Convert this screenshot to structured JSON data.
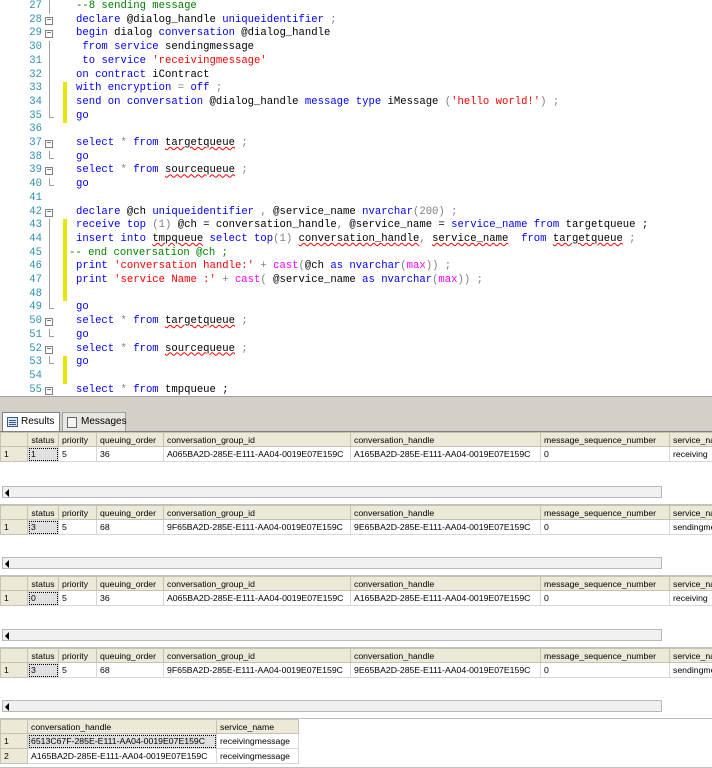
{
  "editor": {
    "lines": [
      {
        "n": "27",
        "tokens": [
          {
            "t": "--8 sending message",
            "c": "cmt"
          }
        ],
        "marker": false,
        "fold": "line"
      },
      {
        "n": "28",
        "tokens": [
          {
            "t": "declare",
            "c": "kw"
          },
          {
            "t": " @dialog_handle ",
            "c": "plain"
          },
          {
            "t": "uniqueidentifier",
            "c": "kw"
          },
          {
            "t": " ;",
            "c": "gray"
          }
        ],
        "marker": false,
        "fold": "box"
      },
      {
        "n": "29",
        "tokens": [
          {
            "t": "begin",
            "c": "kw"
          },
          {
            "t": " dialog ",
            "c": "plain"
          },
          {
            "t": "conversation",
            "c": "kw"
          },
          {
            "t": " @dialog_handle",
            "c": "plain"
          }
        ],
        "marker": false,
        "fold": "box"
      },
      {
        "n": "30",
        "tokens": [
          {
            "t": " from",
            "c": "kw"
          },
          {
            "t": " ",
            "c": "plain"
          },
          {
            "t": "service",
            "c": "kw"
          },
          {
            "t": " sendingmessage",
            "c": "plain"
          }
        ],
        "marker": false,
        "fold": "line"
      },
      {
        "n": "31",
        "tokens": [
          {
            "t": " to",
            "c": "kw"
          },
          {
            "t": " ",
            "c": "plain"
          },
          {
            "t": "service",
            "c": "kw"
          },
          {
            "t": " ",
            "c": "plain"
          },
          {
            "t": "'receivingmessage'",
            "c": "str"
          }
        ],
        "marker": false,
        "fold": "line"
      },
      {
        "n": "32",
        "tokens": [
          {
            "t": "on",
            "c": "kw"
          },
          {
            "t": " ",
            "c": "plain"
          },
          {
            "t": "contract",
            "c": "kw"
          },
          {
            "t": " iContract",
            "c": "plain"
          }
        ],
        "marker": false,
        "fold": "line"
      },
      {
        "n": "33",
        "tokens": [
          {
            "t": "with",
            "c": "kw"
          },
          {
            "t": " ",
            "c": "plain"
          },
          {
            "t": "encryption",
            "c": "kw"
          },
          {
            "t": " = ",
            "c": "gray"
          },
          {
            "t": "off",
            "c": "kw"
          },
          {
            "t": " ;",
            "c": "gray"
          }
        ],
        "marker": true,
        "fold": "line"
      },
      {
        "n": "34",
        "tokens": [
          {
            "t": "send",
            "c": "kw"
          },
          {
            "t": " ",
            "c": "plain"
          },
          {
            "t": "on",
            "c": "kw"
          },
          {
            "t": " ",
            "c": "plain"
          },
          {
            "t": "conversation",
            "c": "kw"
          },
          {
            "t": " @dialog_handle ",
            "c": "plain"
          },
          {
            "t": "message",
            "c": "kw"
          },
          {
            "t": " ",
            "c": "plain"
          },
          {
            "t": "type",
            "c": "kw"
          },
          {
            "t": " iMessage ",
            "c": "plain"
          },
          {
            "t": "(",
            "c": "gray"
          },
          {
            "t": "'hello world!'",
            "c": "str"
          },
          {
            "t": ") ;",
            "c": "gray"
          }
        ],
        "marker": true,
        "fold": "line"
      },
      {
        "n": "35",
        "tokens": [
          {
            "t": "go",
            "c": "kw"
          }
        ],
        "marker": true,
        "fold": "end"
      },
      {
        "n": "36",
        "tokens": [],
        "marker": false,
        "fold": "none"
      },
      {
        "n": "37",
        "tokens": [
          {
            "t": "select",
            "c": "kw"
          },
          {
            "t": " * ",
            "c": "gray"
          },
          {
            "t": "from",
            "c": "kw"
          },
          {
            "t": " ",
            "c": "plain"
          },
          {
            "t": "targetqueue",
            "c": "squig"
          },
          {
            "t": " ;",
            "c": "gray"
          }
        ],
        "marker": false,
        "fold": "box"
      },
      {
        "n": "38",
        "tokens": [
          {
            "t": "go",
            "c": "kw"
          }
        ],
        "marker": false,
        "fold": "end"
      },
      {
        "n": "39",
        "tokens": [
          {
            "t": "select",
            "c": "kw"
          },
          {
            "t": " * ",
            "c": "gray"
          },
          {
            "t": "from",
            "c": "kw"
          },
          {
            "t": " ",
            "c": "plain"
          },
          {
            "t": "sourcequeue",
            "c": "squig"
          },
          {
            "t": " ;",
            "c": "gray"
          }
        ],
        "marker": false,
        "fold": "box"
      },
      {
        "n": "40",
        "tokens": [
          {
            "t": "go",
            "c": "kw"
          }
        ],
        "marker": false,
        "fold": "end"
      },
      {
        "n": "41",
        "tokens": [],
        "marker": false,
        "fold": "none"
      },
      {
        "n": "42",
        "tokens": [
          {
            "t": "declare",
            "c": "kw"
          },
          {
            "t": " @ch ",
            "c": "plain"
          },
          {
            "t": "uniqueidentifier",
            "c": "kw"
          },
          {
            "t": " , ",
            "c": "gray"
          },
          {
            "t": "@service_name ",
            "c": "plain"
          },
          {
            "t": "nvarchar",
            "c": "kw"
          },
          {
            "t": "(200) ;",
            "c": "gray"
          }
        ],
        "marker": false,
        "fold": "box"
      },
      {
        "n": "43",
        "tokens": [
          {
            "t": "receive",
            "c": "kw"
          },
          {
            "t": " ",
            "c": "plain"
          },
          {
            "t": "top",
            "c": "kw"
          },
          {
            "t": " (1) ",
            "c": "gray"
          },
          {
            "t": "@ch = ",
            "c": "plain"
          },
          {
            "t": "conversation_handle",
            "c": "plain"
          },
          {
            "t": ", ",
            "c": "gray"
          },
          {
            "t": "@service_name = ",
            "c": "plain"
          },
          {
            "t": "service_name",
            "c": "kw"
          },
          {
            "t": " ",
            "c": "plain"
          },
          {
            "t": "from",
            "c": "kw"
          },
          {
            "t": " targetqueue ;",
            "c": "plain"
          }
        ],
        "marker": true,
        "fold": "line"
      },
      {
        "n": "44",
        "tokens": [
          {
            "t": "insert",
            "c": "kw"
          },
          {
            "t": " ",
            "c": "plain"
          },
          {
            "t": "into",
            "c": "kw"
          },
          {
            "t": " ",
            "c": "plain"
          },
          {
            "t": "tmpqueue",
            "c": "squig"
          },
          {
            "t": " ",
            "c": "plain"
          },
          {
            "t": "select",
            "c": "kw"
          },
          {
            "t": " ",
            "c": "plain"
          },
          {
            "t": "top",
            "c": "kw"
          },
          {
            "t": "(1) ",
            "c": "gray"
          },
          {
            "t": "conversation_handle",
            "c": "squig"
          },
          {
            "t": ", ",
            "c": "gray"
          },
          {
            "t": "service_name",
            "c": "squig"
          },
          {
            "t": "  ",
            "c": "plain"
          },
          {
            "t": "from",
            "c": "kw"
          },
          {
            "t": " ",
            "c": "plain"
          },
          {
            "t": "targetqueue",
            "c": "squig"
          },
          {
            "t": " ;",
            "c": "gray"
          }
        ],
        "marker": true,
        "fold": "line"
      },
      {
        "n": "45",
        "tokens": [
          {
            "t": "-- end conversation @ch ;",
            "c": "cmt"
          }
        ],
        "marker": true,
        "fold": "line",
        "indent": -1
      },
      {
        "n": "46",
        "tokens": [
          {
            "t": "print",
            "c": "kw"
          },
          {
            "t": " ",
            "c": "plain"
          },
          {
            "t": "'conversation handle:'",
            "c": "str"
          },
          {
            "t": " + ",
            "c": "gray"
          },
          {
            "t": "cast",
            "c": "fn"
          },
          {
            "t": "(",
            "c": "gray"
          },
          {
            "t": "@ch ",
            "c": "plain"
          },
          {
            "t": "as",
            "c": "kw"
          },
          {
            "t": " ",
            "c": "plain"
          },
          {
            "t": "nvarchar",
            "c": "kw"
          },
          {
            "t": "(",
            "c": "gray"
          },
          {
            "t": "max",
            "c": "fn"
          },
          {
            "t": ")) ;",
            "c": "gray"
          }
        ],
        "marker": true,
        "fold": "line"
      },
      {
        "n": "47",
        "tokens": [
          {
            "t": "print",
            "c": "kw"
          },
          {
            "t": " ",
            "c": "plain"
          },
          {
            "t": "'service Name :'",
            "c": "str"
          },
          {
            "t": " + ",
            "c": "gray"
          },
          {
            "t": "cast",
            "c": "fn"
          },
          {
            "t": "( ",
            "c": "gray"
          },
          {
            "t": "@service_name ",
            "c": "plain"
          },
          {
            "t": "as",
            "c": "kw"
          },
          {
            "t": " ",
            "c": "plain"
          },
          {
            "t": "nvarchar",
            "c": "kw"
          },
          {
            "t": "(",
            "c": "gray"
          },
          {
            "t": "max",
            "c": "fn"
          },
          {
            "t": ")) ;",
            "c": "gray"
          }
        ],
        "marker": true,
        "fold": "line"
      },
      {
        "n": "48",
        "tokens": [],
        "marker": true,
        "fold": "line"
      },
      {
        "n": "49",
        "tokens": [
          {
            "t": "go",
            "c": "kw"
          }
        ],
        "marker": false,
        "fold": "end"
      },
      {
        "n": "50",
        "tokens": [
          {
            "t": "select",
            "c": "kw"
          },
          {
            "t": " * ",
            "c": "gray"
          },
          {
            "t": "from",
            "c": "kw"
          },
          {
            "t": " ",
            "c": "plain"
          },
          {
            "t": "targetqueue",
            "c": "squig"
          },
          {
            "t": " ;",
            "c": "gray"
          }
        ],
        "marker": false,
        "fold": "box"
      },
      {
        "n": "51",
        "tokens": [
          {
            "t": "go",
            "c": "kw"
          }
        ],
        "marker": false,
        "fold": "end"
      },
      {
        "n": "52",
        "tokens": [
          {
            "t": "select",
            "c": "kw"
          },
          {
            "t": " * ",
            "c": "gray"
          },
          {
            "t": "from",
            "c": "kw"
          },
          {
            "t": " ",
            "c": "plain"
          },
          {
            "t": "sourcequeue",
            "c": "squig"
          },
          {
            "t": " ;",
            "c": "gray"
          }
        ],
        "marker": false,
        "fold": "box"
      },
      {
        "n": "53",
        "tokens": [
          {
            "t": "go",
            "c": "kw"
          }
        ],
        "marker": true,
        "fold": "end"
      },
      {
        "n": "54",
        "tokens": [],
        "marker": true,
        "fold": "none"
      },
      {
        "n": "55",
        "tokens": [
          {
            "t": "select",
            "c": "kw"
          },
          {
            "t": " * ",
            "c": "gray"
          },
          {
            "t": "from",
            "c": "kw"
          },
          {
            "t": " tmpqueue ;",
            "c": "plain"
          }
        ],
        "marker": false,
        "fold": "box"
      }
    ]
  },
  "tabs": {
    "results": "Results",
    "messages": "Messages"
  },
  "grids": [
    {
      "columns": [
        "status",
        "priority",
        "queuing_order",
        "conversation_group_id",
        "conversation_handle",
        "message_sequence_number",
        "service_na"
      ],
      "rows": [
        {
          "num": "1",
          "cells": [
            "1",
            "5",
            "36",
            "A065BA2D-285E-E111-AA04-0019E07E159C",
            "A165BA2D-285E-E111-AA04-0019E07E159C",
            "0",
            "receiving"
          ]
        }
      ]
    },
    {
      "columns": [
        "status",
        "priority",
        "queuing_order",
        "conversation_group_id",
        "conversation_handle",
        "message_sequence_number",
        "service_na"
      ],
      "rows": [
        {
          "num": "1",
          "cells": [
            "3",
            "5",
            "68",
            "9F65BA2D-285E-E111-AA04-0019E07E159C",
            "9E65BA2D-285E-E111-AA04-0019E07E159C",
            "0",
            "sendingme"
          ]
        }
      ]
    },
    {
      "columns": [
        "status",
        "priority",
        "queuing_order",
        "conversation_group_id",
        "conversation_handle",
        "message_sequence_number",
        "service_na"
      ],
      "rows": [
        {
          "num": "1",
          "cells": [
            "0",
            "5",
            "36",
            "A065BA2D-285E-E111-AA04-0019E07E159C",
            "A165BA2D-285E-E111-AA04-0019E07E159C",
            "0",
            "receiving"
          ]
        }
      ]
    },
    {
      "columns": [
        "status",
        "priority",
        "queuing_order",
        "conversation_group_id",
        "conversation_handle",
        "message_sequence_number",
        "service_na"
      ],
      "rows": [
        {
          "num": "1",
          "cells": [
            "3",
            "5",
            "68",
            "9F65BA2D-285E-E111-AA04-0019E07E159C",
            "9E65BA2D-285E-E111-AA04-0019E07E159C",
            "0",
            "sendingme"
          ]
        }
      ]
    },
    {
      "columns": [
        "conversation_handle",
        "service_name"
      ],
      "rows": [
        {
          "num": "1",
          "cells": [
            "6513C67F-285E-E111-AA04-0019E07E159C",
            "receivingmessage"
          ]
        },
        {
          "num": "2",
          "cells": [
            "A165BA2D-285E-E111-AA04-0019E07E159C",
            "receivingmessage"
          ]
        }
      ]
    }
  ]
}
